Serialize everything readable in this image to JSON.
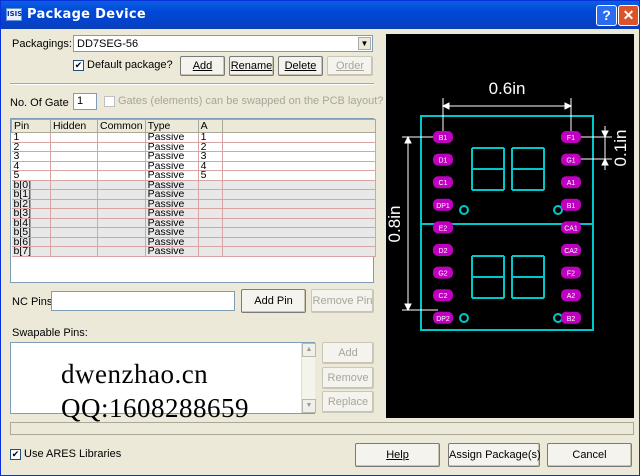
{
  "window": {
    "title": "Package Device",
    "icon_text": "ISIS"
  },
  "packaging": {
    "label": "Packagings:",
    "selected": "DD7SEG-56",
    "default_label": "Default package?",
    "default_checked": true
  },
  "package_buttons": {
    "add": "Add",
    "rename": "Rename",
    "delete": "Delete",
    "order": "Order"
  },
  "gates": {
    "label": "No. Of Gate",
    "value": "1",
    "swap_label": "Gates (elements) can be swapped on the PCB layout?",
    "swap_checked": false
  },
  "pin_table": {
    "columns": [
      "Pin",
      "Hidden",
      "Common",
      "Type",
      "A"
    ],
    "rows": [
      {
        "pin": "1",
        "hidden": "",
        "common": "",
        "type": "Passive",
        "a": "1",
        "bus": false
      },
      {
        "pin": "2",
        "hidden": "",
        "common": "",
        "type": "Passive",
        "a": "2",
        "bus": false
      },
      {
        "pin": "3",
        "hidden": "",
        "common": "",
        "type": "Passive",
        "a": "3",
        "bus": false
      },
      {
        "pin": "4",
        "hidden": "",
        "common": "",
        "type": "Passive",
        "a": "4",
        "bus": false
      },
      {
        "pin": "5",
        "hidden": "",
        "common": "",
        "type": "Passive",
        "a": "5",
        "bus": false
      },
      {
        "pin": "b[0]",
        "hidden": "",
        "common": "",
        "type": "Passive",
        "a": "",
        "bus": true
      },
      {
        "pin": "b[1]",
        "hidden": "",
        "common": "",
        "type": "Passive",
        "a": "",
        "bus": true
      },
      {
        "pin": "b[2]",
        "hidden": "",
        "common": "",
        "type": "Passive",
        "a": "",
        "bus": true
      },
      {
        "pin": "b[3]",
        "hidden": "",
        "common": "",
        "type": "Passive",
        "a": "",
        "bus": true
      },
      {
        "pin": "b[4]",
        "hidden": "",
        "common": "",
        "type": "Passive",
        "a": "",
        "bus": true
      },
      {
        "pin": "b[5]",
        "hidden": "",
        "common": "",
        "type": "Passive",
        "a": "",
        "bus": true
      },
      {
        "pin": "b[6]",
        "hidden": "",
        "common": "",
        "type": "Passive",
        "a": "",
        "bus": true
      },
      {
        "pin": "b[7]",
        "hidden": "",
        "common": "",
        "type": "Passive",
        "a": "",
        "bus": true
      }
    ]
  },
  "nc_pins": {
    "label": "NC Pins",
    "value": "",
    "add_pin": "Add Pin",
    "remove_pin": "Remove Pin"
  },
  "swapable": {
    "label": "Swapable Pins:",
    "add": "Add",
    "remove": "Remove",
    "replace": "Replace"
  },
  "watermark": {
    "line1": "dwenzhao.cn",
    "line2": "QQ:1608288659"
  },
  "preview": {
    "dim_width": "0.6in",
    "dim_height": "0.8in",
    "dim_pitch": "0.1in",
    "left_pads": [
      "B1",
      "D1",
      "C1",
      "DP1",
      "E2",
      "D2",
      "G2",
      "C2",
      "DP2"
    ],
    "right_pads": [
      "F1",
      "G1",
      "A1",
      "B1",
      "CA1",
      "CA2",
      "F2",
      "A2",
      "B2"
    ],
    "colors": {
      "outline": "#00c8c8",
      "pad": "#c000c0",
      "dimension": "#ffffff"
    }
  },
  "footer": {
    "ares_label": "Use ARES Libraries",
    "ares_checked": true,
    "help": "Help",
    "assign": "Assign Package(s)",
    "cancel": "Cancel"
  }
}
